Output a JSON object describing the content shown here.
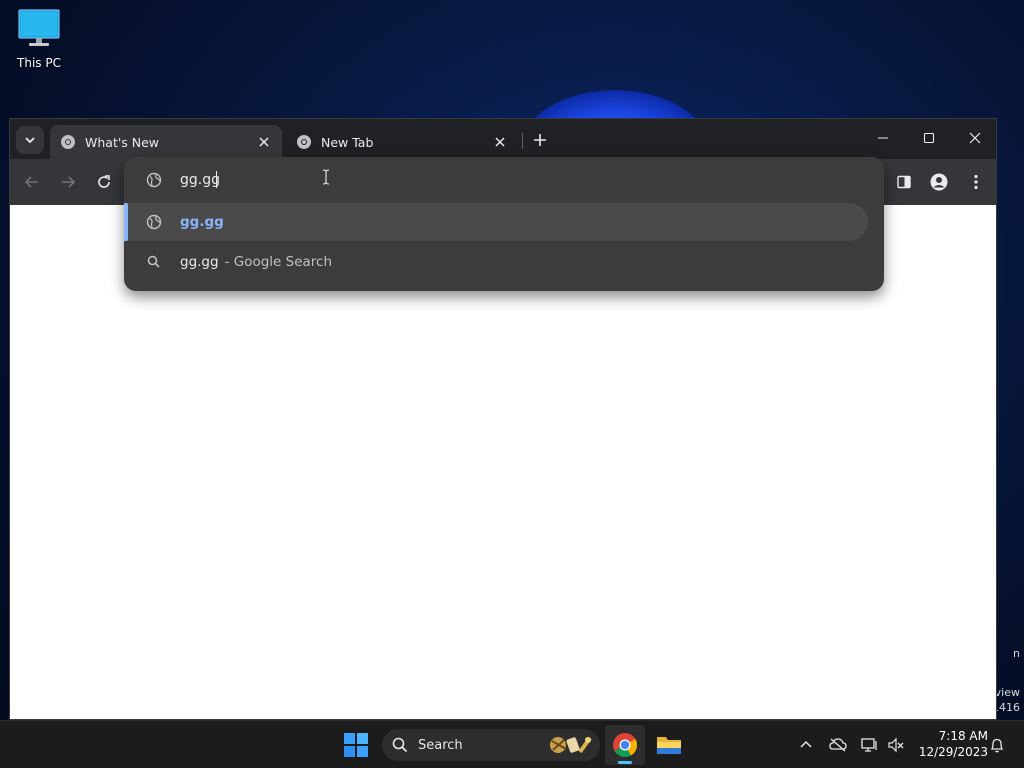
{
  "desktop": {
    "icons": [
      {
        "label": "This PC"
      }
    ],
    "watermark_lines": [
      "n",
      "view",
      "1416"
    ]
  },
  "browser": {
    "tabs": [
      {
        "title": "What's New",
        "active": true
      },
      {
        "title": "New Tab",
        "active": false
      }
    ],
    "omnibox": {
      "value": "gg.gg",
      "suggestions": [
        {
          "text": "gg.gg",
          "type": "url",
          "icon": "globe-icon"
        },
        {
          "text": "gg.gg",
          "description": "- Google Search",
          "type": "search",
          "icon": "search-icon"
        }
      ]
    }
  },
  "taskbar": {
    "search_label": "Search",
    "clock": {
      "time": "7:18 AM",
      "date": "12/29/2023"
    }
  },
  "colors": {
    "accent": "#8ab4f8",
    "tabstrip": "#202124",
    "toolbar": "#35363a",
    "popup": "#3c3c3c"
  }
}
